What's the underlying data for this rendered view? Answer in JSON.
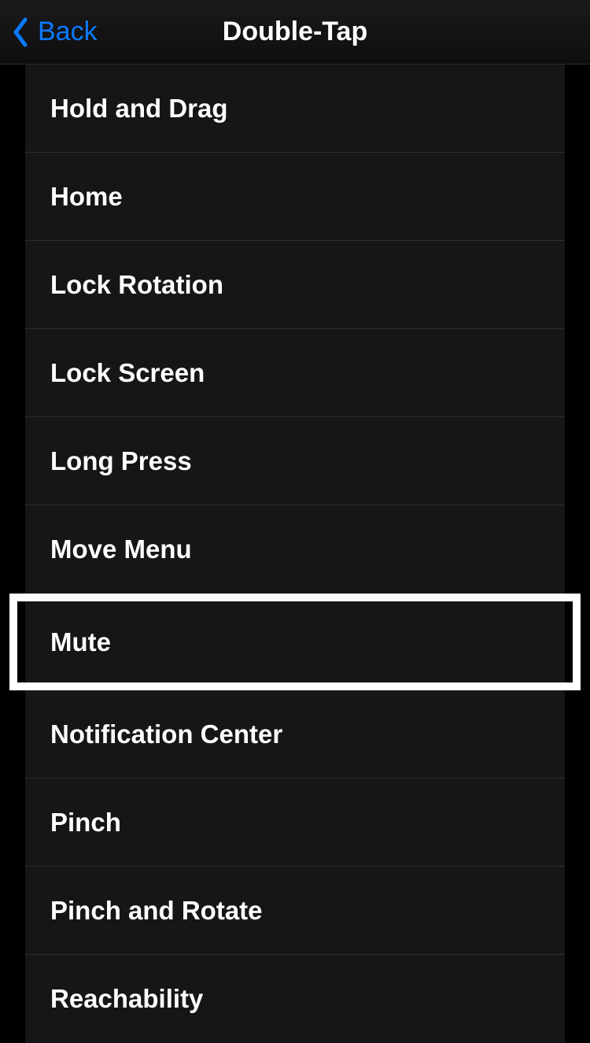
{
  "nav": {
    "back_label": "Back",
    "title": "Double-Tap"
  },
  "options": [
    {
      "label": "Hold and Drag",
      "highlighted": false
    },
    {
      "label": "Home",
      "highlighted": false
    },
    {
      "label": "Lock Rotation",
      "highlighted": false
    },
    {
      "label": "Lock Screen",
      "highlighted": false
    },
    {
      "label": "Long Press",
      "highlighted": false
    },
    {
      "label": "Move Menu",
      "highlighted": false
    },
    {
      "label": "Mute",
      "highlighted": true
    },
    {
      "label": "Notification Center",
      "highlighted": false
    },
    {
      "label": "Pinch",
      "highlighted": false
    },
    {
      "label": "Pinch and Rotate",
      "highlighted": false
    },
    {
      "label": "Reachability",
      "highlighted": false
    }
  ]
}
